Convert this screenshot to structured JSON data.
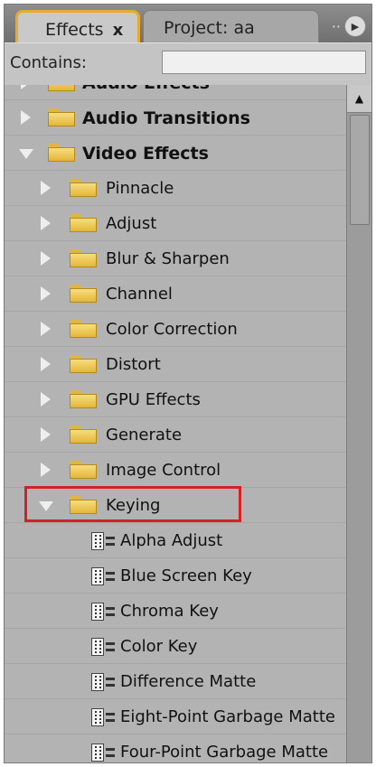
{
  "tabs": [
    {
      "label": "Effects",
      "close": "x",
      "active": true
    },
    {
      "label": "Project: aa",
      "active": false
    }
  ],
  "panel_menu_icon": "panel-menu-arrow-icon",
  "filter": {
    "label": "Contains:",
    "value": ""
  },
  "tree": {
    "items": [
      {
        "label": "Audio Effects",
        "type": "folder",
        "level": 0,
        "expanded": false,
        "bold": true
      },
      {
        "label": "Audio Transitions",
        "type": "folder",
        "level": 0,
        "expanded": false,
        "bold": true
      },
      {
        "label": "Video Effects",
        "type": "folder",
        "level": 0,
        "expanded": true,
        "bold": true
      },
      {
        "label": "Pinnacle",
        "type": "folder",
        "level": 1,
        "expanded": false
      },
      {
        "label": "Adjust",
        "type": "folder",
        "level": 1,
        "expanded": false
      },
      {
        "label": "Blur & Sharpen",
        "type": "folder",
        "level": 1,
        "expanded": false
      },
      {
        "label": "Channel",
        "type": "folder",
        "level": 1,
        "expanded": false
      },
      {
        "label": "Color Correction",
        "type": "folder",
        "level": 1,
        "expanded": false
      },
      {
        "label": "Distort",
        "type": "folder",
        "level": 1,
        "expanded": false
      },
      {
        "label": "GPU Effects",
        "type": "folder",
        "level": 1,
        "expanded": false
      },
      {
        "label": "Generate",
        "type": "folder",
        "level": 1,
        "expanded": false
      },
      {
        "label": "Image Control",
        "type": "folder",
        "level": 1,
        "expanded": false
      },
      {
        "label": "Keying",
        "type": "folder",
        "level": 1,
        "expanded": true,
        "highlighted": true
      },
      {
        "label": "Alpha Adjust",
        "type": "effect",
        "level": 2
      },
      {
        "label": "Blue Screen Key",
        "type": "effect",
        "level": 2
      },
      {
        "label": "Chroma Key",
        "type": "effect",
        "level": 2
      },
      {
        "label": "Color Key",
        "type": "effect",
        "level": 2
      },
      {
        "label": "Difference Matte",
        "type": "effect",
        "level": 2
      },
      {
        "label": "Eight-Point Garbage Matte",
        "type": "effect",
        "level": 2
      },
      {
        "label": "Four-Point Garbage Matte",
        "type": "effect",
        "level": 2
      }
    ]
  },
  "colors": {
    "panel_bg": "#b3b3b3",
    "active_tab_border": "#e9a92a",
    "highlight_box": "#d42128",
    "folder": "#f2cd5e"
  }
}
